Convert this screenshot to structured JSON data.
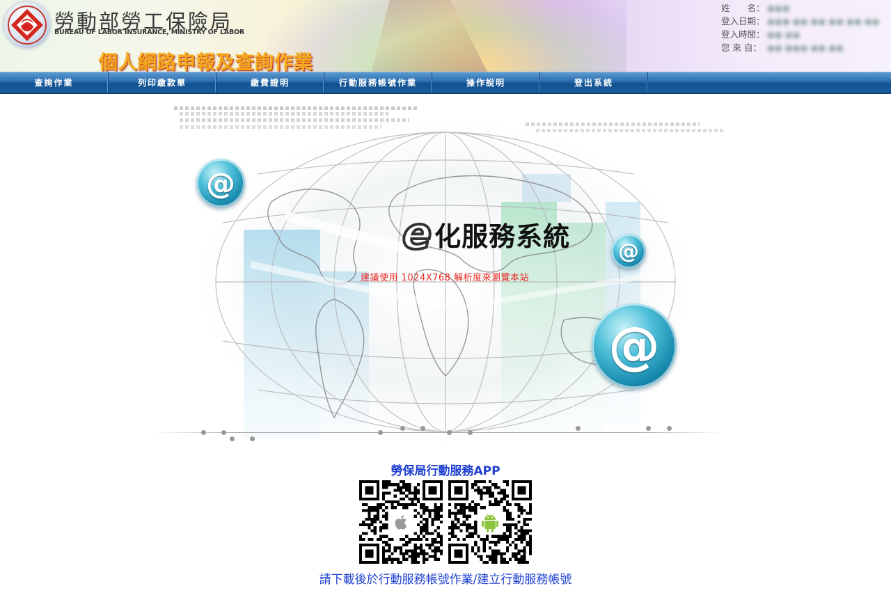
{
  "header": {
    "org_name_cn": "勞動部勞工保險局",
    "org_name_en": "BUREAU OF LABOR INSURANCE, MINISTRY OF LABOR",
    "app_title": "個人網路申報及查詢作業",
    "logo_icon": "bli-emblem-icon",
    "user_info": [
      {
        "label": "姓　　名：",
        "value": "●●●"
      },
      {
        "label": "登入日期：",
        "value": "●●● ●● ●● ●● ●● ●●"
      },
      {
        "label": "登入時間：",
        "value": "●● ●●"
      },
      {
        "label": "您 來 自：",
        "value": "●● ●●● ●●.●●"
      }
    ]
  },
  "nav": {
    "items": [
      {
        "label": "查詢作業"
      },
      {
        "label": "列印繳款單"
      },
      {
        "label": "繳費證明"
      },
      {
        "label": "行動服務帳號作業"
      },
      {
        "label": "操作說明"
      },
      {
        "label": "登出系統"
      }
    ]
  },
  "hero": {
    "e_mark": "e",
    "service_title": "化服務系統",
    "resolution_note": "建議使用  1024X768  解析度來瀏覽本站",
    "at_symbol": "@"
  },
  "app": {
    "heading": "勞保局行動服務APP",
    "ios_icon": "apple-icon",
    "android_icon": "android-icon",
    "download_note": "請下載後於行動服務帳號作業/建立行動服務帳號"
  },
  "colors": {
    "nav_blue": "#1a5d9e",
    "title_orange": "#f3a81d",
    "link_blue": "#1e3fd0",
    "warning_red": "#e8251f"
  }
}
